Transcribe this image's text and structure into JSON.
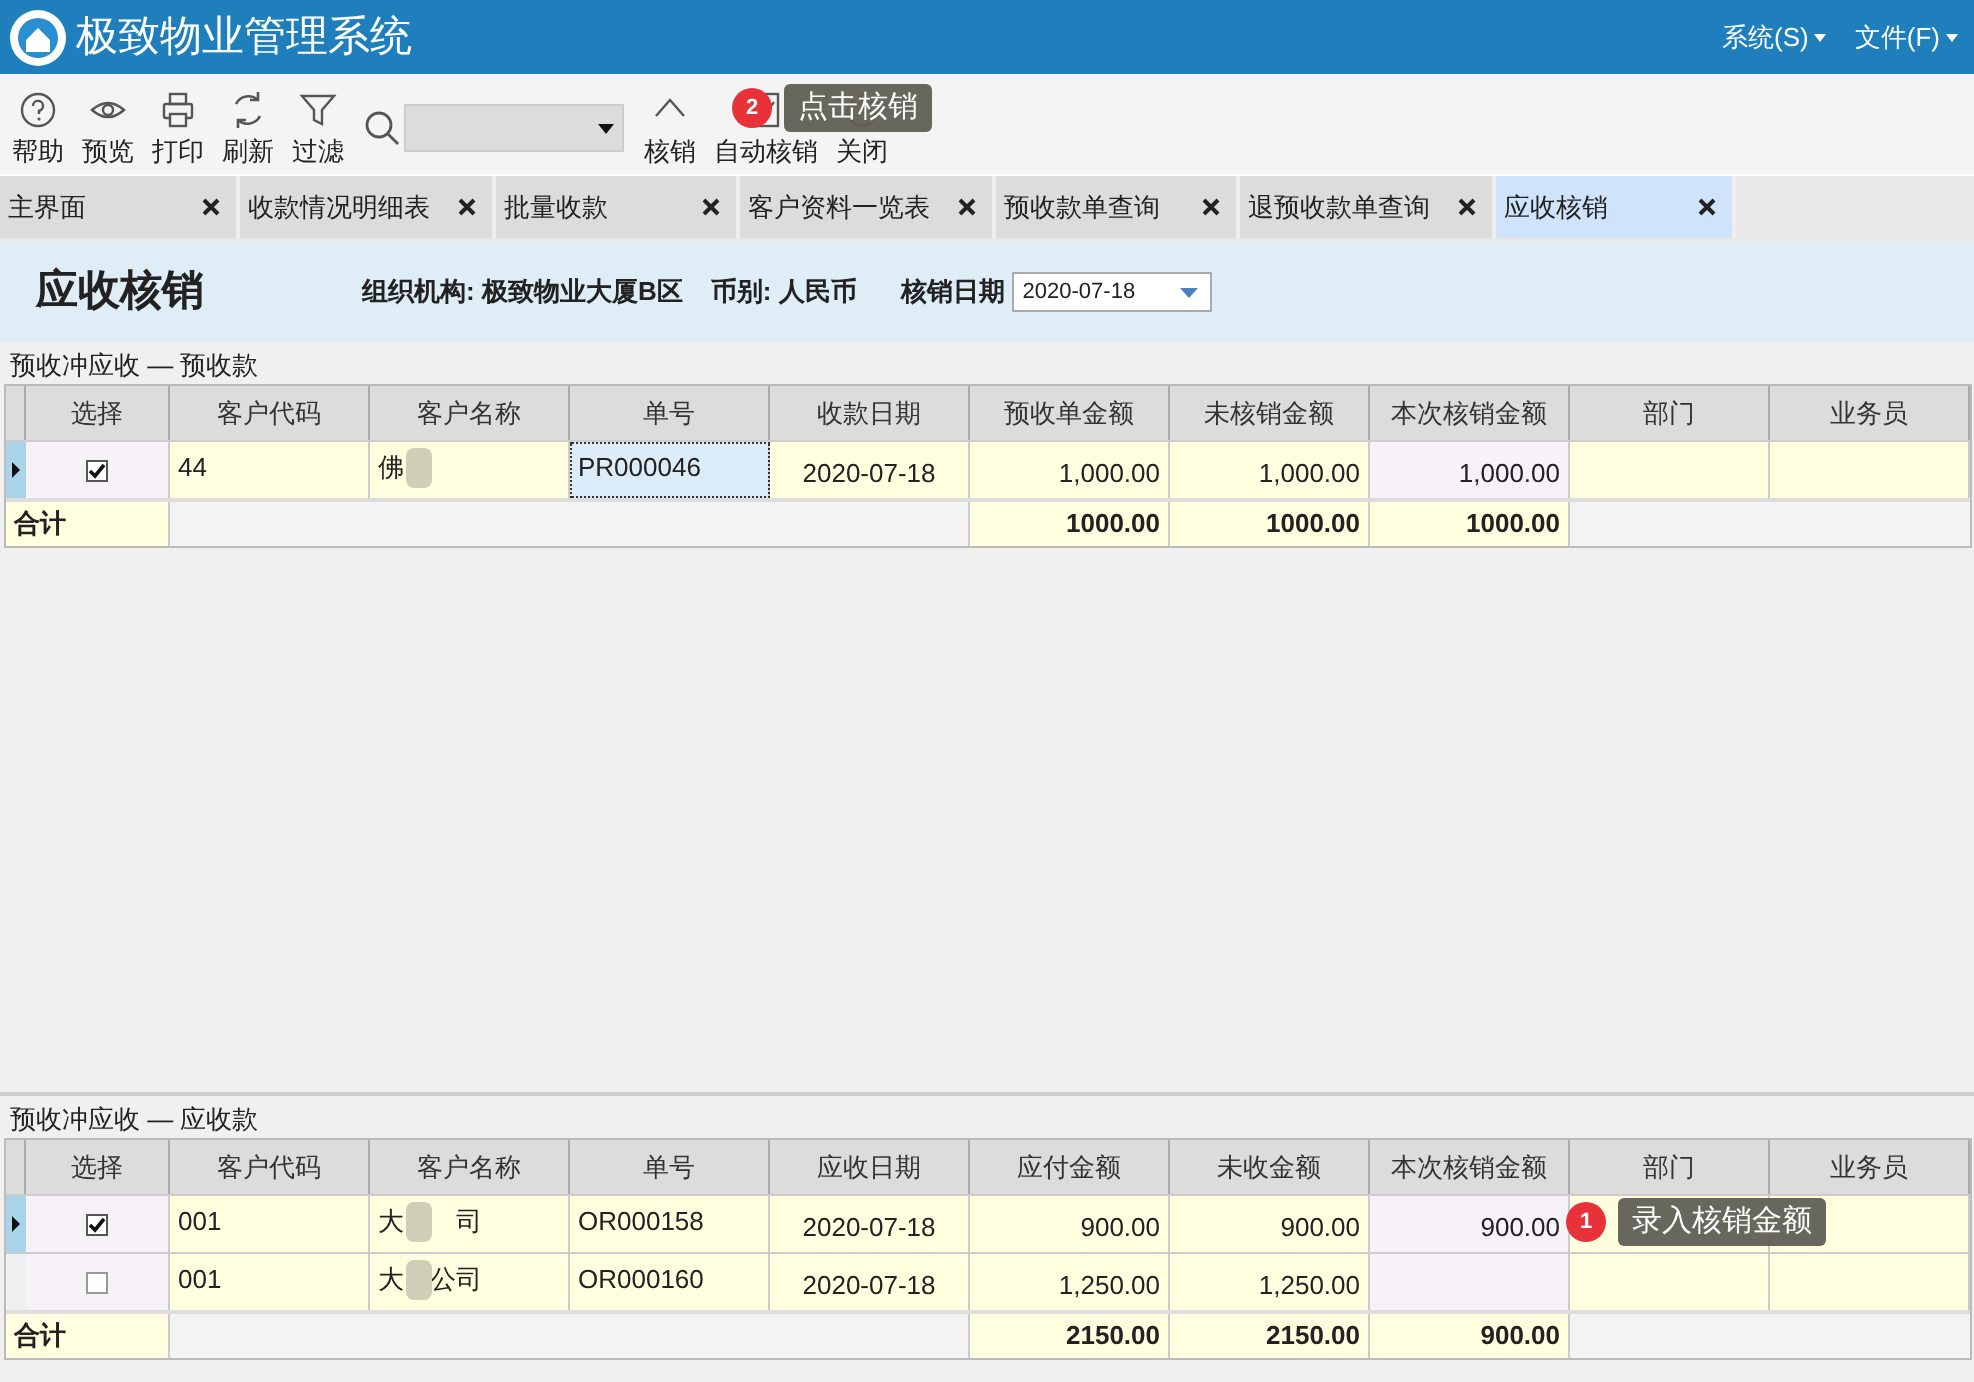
{
  "app": {
    "title": "极致物业管理系统",
    "menus": [
      "系统(S)",
      "文件(F)"
    ]
  },
  "toolbar": {
    "buttons": [
      {
        "label": "帮助",
        "kind": "help"
      },
      {
        "label": "预览",
        "kind": "preview"
      },
      {
        "label": "打印",
        "kind": "print"
      },
      {
        "label": "刷新",
        "kind": "refresh"
      },
      {
        "label": "过滤",
        "kind": "filter"
      },
      {
        "kind": "search"
      },
      {
        "label": "核销",
        "kind": "writeoff"
      },
      {
        "label": "自动核销",
        "kind": "auto"
      },
      {
        "label": "关闭",
        "kind": "close"
      }
    ]
  },
  "tabs": [
    {
      "label": "主界面",
      "selected": false
    },
    {
      "label": "收款情况明细表",
      "selected": false
    },
    {
      "label": "批量收款",
      "selected": false
    },
    {
      "label": "客户资料一览表",
      "selected": false
    },
    {
      "label": "预收款单查询",
      "selected": false
    },
    {
      "label": "退预收款单查询",
      "selected": false
    },
    {
      "label": "应收核销",
      "selected": true
    }
  ],
  "header": {
    "title": "应收核销",
    "org": "组织机构: 极致物业大厦B区",
    "currency": "币别: 人民币",
    "date_label": "核销日期",
    "date": "2020-07-18"
  },
  "grids": [
    {
      "label": "预收冲应收 — 预收款",
      "columns": [
        "选择",
        "客户代码",
        "客户名称",
        "单号",
        "收款日期",
        "预收单金额",
        "未核销金额",
        "本次核销金额",
        "部门",
        "业务员"
      ],
      "rows": [
        {
          "current": true,
          "checked": true,
          "number_focused": true,
          "cells": {
            "code": "44",
            "name": "佛",
            "number": "PR000046",
            "date": "2020-07-18",
            "amount": "1,000.00",
            "open": "1,000.00",
            "writeoff": "1,000.00"
          }
        }
      ],
      "total": {
        "label": "合计",
        "amount": "1000.00",
        "open": "1000.00",
        "writeoff": "1000.00"
      }
    },
    {
      "label": "预收冲应收 — 应收款",
      "columns": [
        "选择",
        "客户代码",
        "客户名称",
        "单号",
        "应收日期",
        "应付金额",
        "未收金额",
        "本次核销金额",
        "部门",
        "业务员"
      ],
      "rows": [
        {
          "current": true,
          "checked": true,
          "number_focused": false,
          "cells": {
            "code": "001",
            "name": "大　　司",
            "number": "OR000158",
            "date": "2020-07-18",
            "amount": "900.00",
            "open": "900.00",
            "writeoff": "900.00"
          }
        },
        {
          "current": false,
          "checked": false,
          "number_focused": false,
          "cells": {
            "code": "001",
            "name": "大　公司",
            "number": "OR000160",
            "date": "2020-07-18",
            "amount": "1,250.00",
            "open": "1,250.00"
          }
        }
      ],
      "total": {
        "label": "合计",
        "amount": "2150.00",
        "open": "2150.00",
        "writeoff": "900.00"
      }
    }
  ],
  "callouts": [
    {
      "number": "2",
      "text": "点击核销"
    },
    {
      "number": "1",
      "text": "录入核销金额"
    }
  ]
}
